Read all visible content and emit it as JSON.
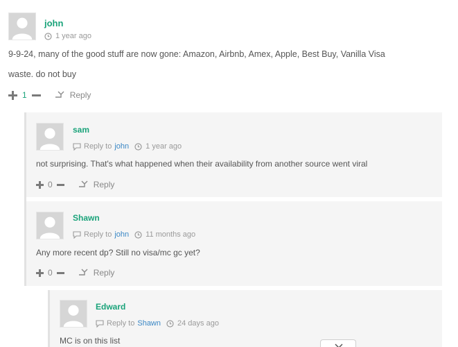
{
  "comments": [
    {
      "author": "john",
      "time": "1 year ago",
      "lines": [
        "9-9-24, many of the good stuff are now gone: Amazon, Airbnb, Amex, Apple, Best Buy, Vanilla Visa",
        "waste. do not buy"
      ],
      "votes": "1",
      "reply_label": "Reply"
    },
    {
      "author": "sam",
      "reply_to_label": "Reply to",
      "reply_to": "john",
      "time": "1 year ago",
      "text": "not surprising. That's what happened when their availability from another source went viral",
      "votes": "0",
      "reply_label": "Reply"
    },
    {
      "author": "Shawn",
      "reply_to_label": "Reply to",
      "reply_to": "john",
      "time": "11 months ago",
      "text": "Any more recent dp? Still no visa/mc gc yet?",
      "votes": "0",
      "reply_label": "Reply"
    },
    {
      "author": "Edward",
      "reply_to_label": "Reply to",
      "reply_to": "Shawn",
      "time": "24 days ago",
      "text": "MC is on this list"
    }
  ],
  "icons": {
    "clock": "clock-icon",
    "reply_arrow": "reply-arrow-icon",
    "reply_to": "reply-to-icon",
    "plus": "upvote-plus-icon",
    "minus": "downvote-minus-icon",
    "chevron": "chevron-down-icon"
  },
  "colors": {
    "author": "#1aa37a",
    "link": "#3a87c5",
    "panel": "#f5f5f5"
  }
}
